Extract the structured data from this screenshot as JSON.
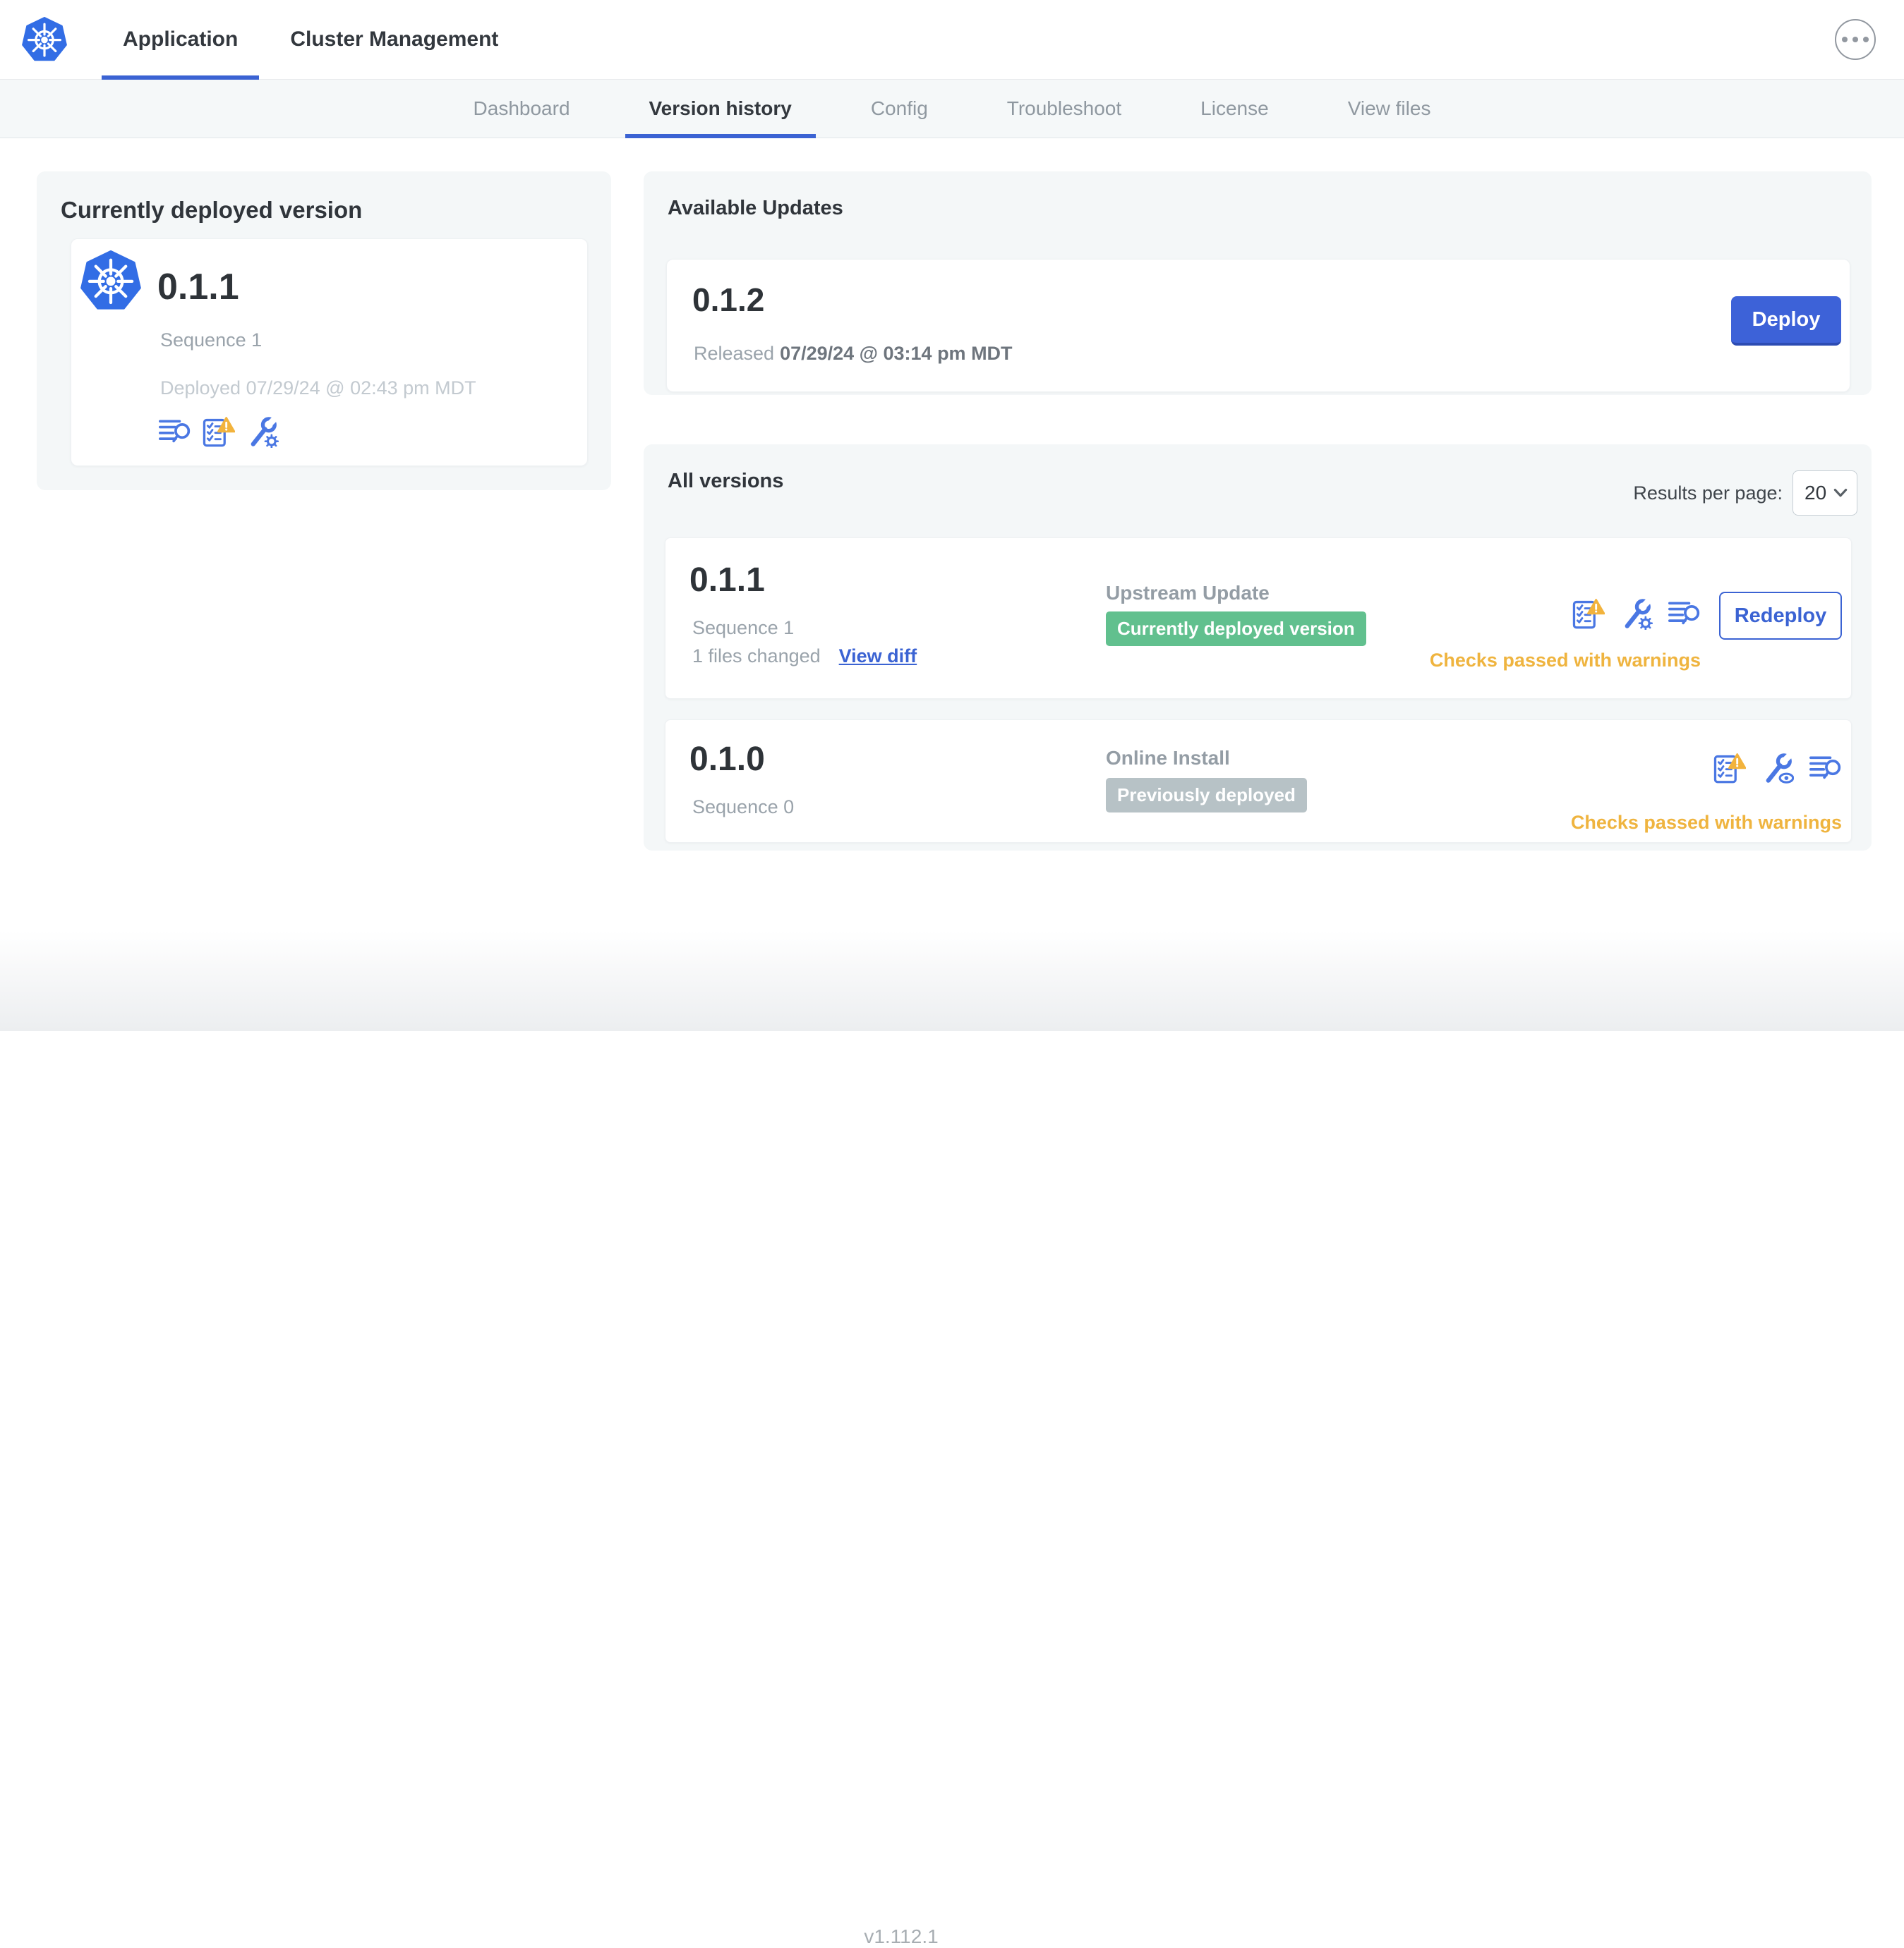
{
  "header": {
    "tabs": [
      {
        "label": "Application"
      },
      {
        "label": "Cluster Management"
      }
    ]
  },
  "subnav": {
    "active": "Version history",
    "tabs": [
      {
        "label": "Dashboard"
      },
      {
        "label": "Version history"
      },
      {
        "label": "Config"
      },
      {
        "label": "Troubleshoot"
      },
      {
        "label": "License"
      },
      {
        "label": "View files"
      }
    ]
  },
  "current_version": {
    "title": "Currently deployed version",
    "version": "0.1.1",
    "sequence": "Sequence 1",
    "deployed": "Deployed 07/29/24 @ 02:43 pm MDT",
    "icons": [
      "deploy-logs-icon",
      "preflight-checks-warning-icon",
      "edit-config-icon"
    ]
  },
  "available_updates": {
    "title": "Available Updates",
    "version": "0.1.2",
    "released_label": "Released",
    "released_date": "07/29/24 @ 03:14 pm MDT",
    "deploy_button": "Deploy"
  },
  "all_versions": {
    "title": "All versions",
    "results_per_page_label": "Results per page:",
    "results_per_page_value": "20",
    "rows": [
      {
        "version": "0.1.1",
        "sequence": "Sequence 1",
        "files_changed": "1 files changed",
        "view_diff_link": "View diff",
        "source": "Upstream Update",
        "badge": "Currently deployed version",
        "badge_color": "#61c08e",
        "status": "Checks passed with warnings",
        "action_button": "Redeploy",
        "icons": [
          "preflight-checks-warning-icon",
          "edit-config-icon",
          "deploy-logs-icon"
        ]
      },
      {
        "version": "0.1.0",
        "sequence": "Sequence 0",
        "source": "Online Install",
        "badge": "Previously deployed",
        "badge_color": "#b7c2c6",
        "status": "Checks passed with warnings",
        "icons": [
          "preflight-checks-warning-icon",
          "view-config-icon",
          "deploy-logs-icon"
        ]
      }
    ]
  },
  "footer": {
    "app_version": "v1.112.1"
  },
  "colors": {
    "accent_blue": "#3b63d3",
    "icon_blue": "#4a77e3",
    "success_green": "#61c08e",
    "muted_badge_gray": "#b7c2c6",
    "warning_orange": "#efb43f",
    "k8s_logo_blue": "#326de5"
  }
}
